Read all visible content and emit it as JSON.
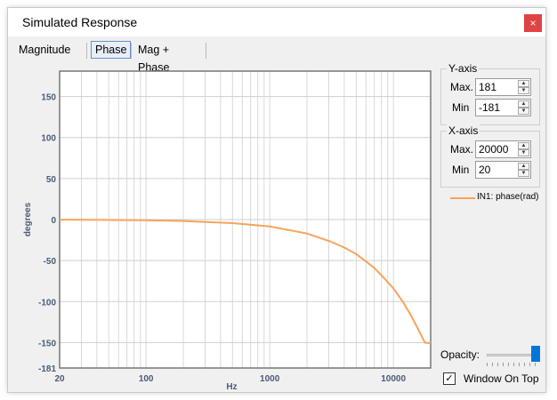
{
  "window": {
    "title": "Simulated Response",
    "close_glyph": "×"
  },
  "tabs": [
    {
      "label": "Magnitude",
      "active": false
    },
    {
      "label": "Phase",
      "active": true
    },
    {
      "label": "Mag + Phase",
      "active": false
    }
  ],
  "y_axis": {
    "title": "Y-axis",
    "max_label": "Max.",
    "max_value": "181",
    "min_label": "Min",
    "min_value": "-181"
  },
  "x_axis": {
    "title": "X-axis",
    "max_label": "Max.",
    "max_value": "20000",
    "min_label": "Min",
    "min_value": "20"
  },
  "legend": {
    "label": "IN1: phase(rad)",
    "color": "#f7a35c"
  },
  "opacity": {
    "label": "Opacity:",
    "value_percent": 100
  },
  "window_on_top": {
    "label": "Window On Top",
    "checked": true,
    "check_glyph": "✓"
  },
  "chart_data": {
    "type": "line",
    "title": "",
    "xlabel": "Hz",
    "ylabel": "degrees",
    "x_scale": "log",
    "xlim": [
      20,
      20000
    ],
    "ylim": [
      -181,
      181
    ],
    "x_ticks": [
      "20",
      "100",
      "1000",
      "10000"
    ],
    "x_tick_values": [
      20,
      100,
      1000,
      10000
    ],
    "y_ticks": [
      "150",
      "100",
      "50",
      "0",
      "-50",
      "-100",
      "-150",
      "-181"
    ],
    "y_tick_values": [
      150,
      100,
      50,
      0,
      -50,
      -100,
      -150,
      -181
    ],
    "grid": true,
    "series": [
      {
        "name": "IN1: phase(rad)",
        "color": "#f7a35c",
        "x": [
          20,
          50,
          100,
          200,
          500,
          1000,
          2000,
          3000,
          4000,
          5000,
          6000,
          7000,
          8000,
          10000,
          12000,
          14000,
          16000,
          18000,
          20000
        ],
        "y": [
          -0.1,
          -0.4,
          -0.9,
          -1.7,
          -4.3,
          -8.5,
          -17,
          -26,
          -34,
          -42,
          -51,
          -59,
          -68,
          -84,
          -101,
          -118,
          -135,
          -150,
          -151
        ]
      }
    ]
  }
}
